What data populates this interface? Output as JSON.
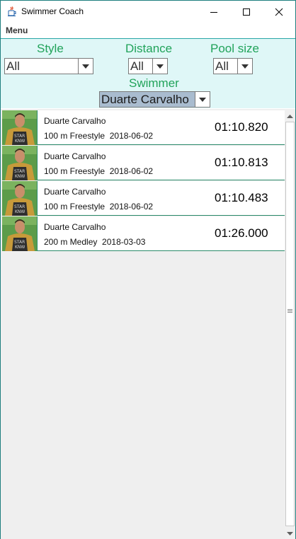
{
  "window": {
    "title": "Swimmer Coach"
  },
  "menu": {
    "label": "Menu"
  },
  "filters": {
    "style": {
      "label": "Style",
      "value": "All"
    },
    "distance": {
      "label": "Distance",
      "value": "All"
    },
    "pool_size": {
      "label": "Pool size",
      "value": "All"
    },
    "swimmer": {
      "label": "Swimmer",
      "value": "Duarte Carvalho"
    }
  },
  "results": [
    {
      "name": "Duarte Carvalho",
      "event": "100 m Freestyle",
      "date": "2018-06-02",
      "time": "01:10.820"
    },
    {
      "name": "Duarte Carvalho",
      "event": "100 m Freestyle",
      "date": "2018-06-02",
      "time": "01:10.813"
    },
    {
      "name": "Duarte Carvalho",
      "event": "100 m Freestyle",
      "date": "2018-06-02",
      "time": "01:10.483"
    },
    {
      "name": "Duarte Carvalho",
      "event": "200 m Medley",
      "date": "2018-03-03",
      "time": "01:26.000"
    }
  ],
  "colors": {
    "accent_green": "#21a35a",
    "filter_bg": "#dff7f7",
    "selected_combo": "#a9bccf",
    "row_border": "#2a8a6a"
  },
  "icons": {
    "app": "java-coffee-cup-icon",
    "minimize": "minimize-icon",
    "maximize": "maximize-icon",
    "close": "close-icon",
    "dropdown": "chevron-down-icon",
    "avatar": "swimmer-photo"
  }
}
